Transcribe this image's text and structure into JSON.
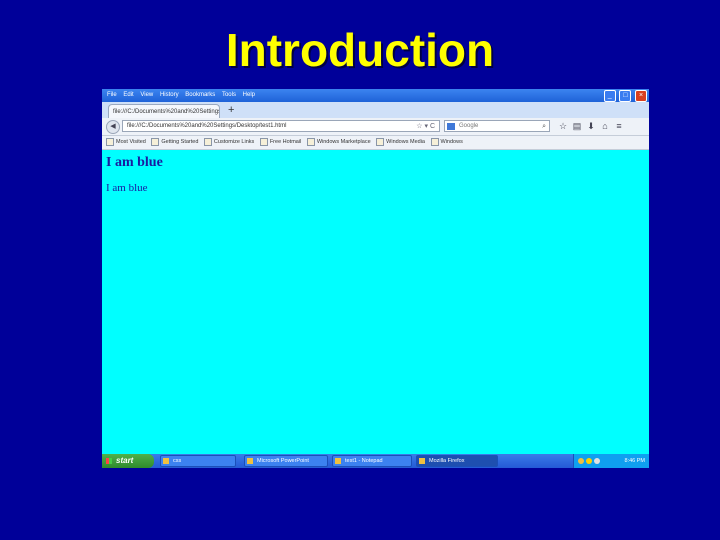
{
  "slide": {
    "title": "Introduction"
  },
  "browser": {
    "menu": [
      "File",
      "Edit",
      "View",
      "History",
      "Bookmarks",
      "Tools",
      "Help"
    ],
    "window_buttons": {
      "minimize": "_",
      "restore": "□",
      "close": "×"
    },
    "tab": {
      "label": "file:///C:/Documents%20and%20Settings/"
    },
    "new_tab": "+",
    "address": {
      "value": "file:///C:/Documents%20and%20Settings/Desktop/test1.html",
      "controls": "☆ ▾ C"
    },
    "search": {
      "placeholder": "Google"
    },
    "bookmarks": [
      "Most Visited",
      "Getting Started",
      "Customize Links",
      "Free Hotmail",
      "Windows Marketplace",
      "Windows Media",
      "Windows"
    ],
    "page": {
      "heading": "I am blue",
      "paragraph": "I am blue",
      "background_color": "#00ffff",
      "text_color": "#1a1aa0"
    }
  },
  "taskbar": {
    "start_label": "start",
    "tasks": [
      "css",
      "Microsoft PowerPoint",
      "test1 - Notepad",
      "Mozilla Firefox"
    ],
    "clock": "8:46 PM"
  }
}
